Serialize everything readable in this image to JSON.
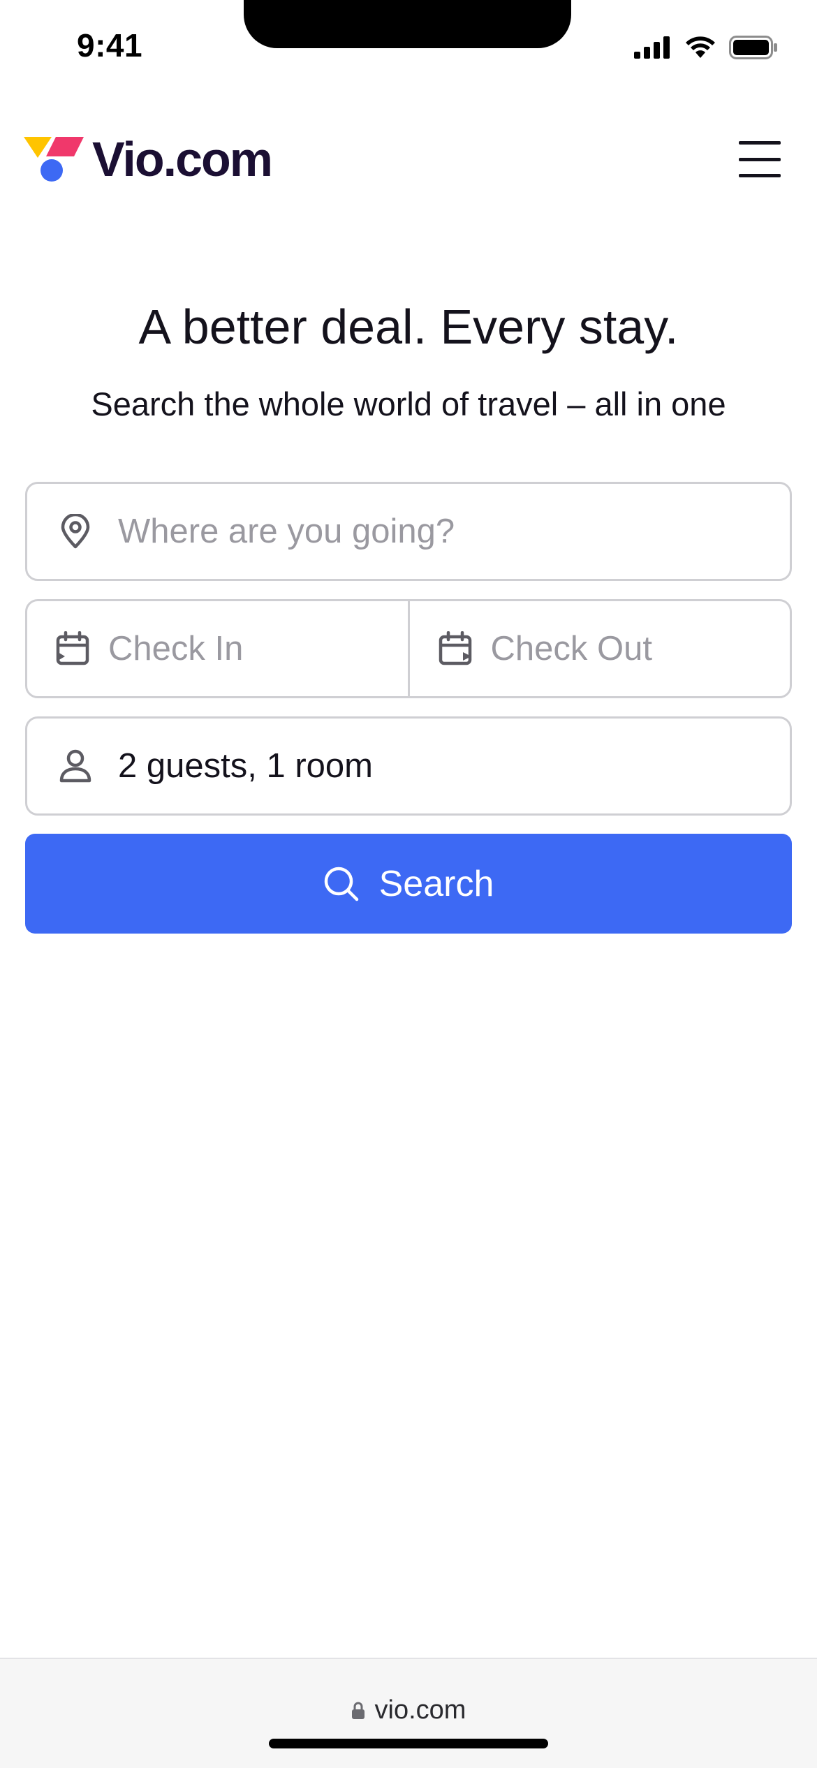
{
  "status_bar": {
    "time": "9:41"
  },
  "header": {
    "logo_text": "Vio.com",
    "brand_colors": {
      "yellow": "#FFC400",
      "pink": "#F0386B",
      "blue": "#3D69F4",
      "wordmark": "#1B0F33"
    },
    "menu_icon": "hamburger-menu-icon"
  },
  "hero": {
    "title": "A better deal. Every stay.",
    "subtitle": "Search the whole world of travel – all in one"
  },
  "search_form": {
    "destination": {
      "icon": "location-pin-icon",
      "placeholder": "Where are you going?",
      "value": ""
    },
    "check_in": {
      "icon": "calendar-check-in-icon",
      "placeholder": "Check In"
    },
    "check_out": {
      "icon": "calendar-check-out-icon",
      "placeholder": "Check Out"
    },
    "guests": {
      "icon": "person-icon",
      "value": "2 guests, 1 room"
    },
    "search_button": {
      "icon": "search-icon",
      "label": "Search",
      "color": "#3D69F4"
    }
  },
  "browser": {
    "url": "vio.com",
    "lock_icon": "lock-icon"
  }
}
